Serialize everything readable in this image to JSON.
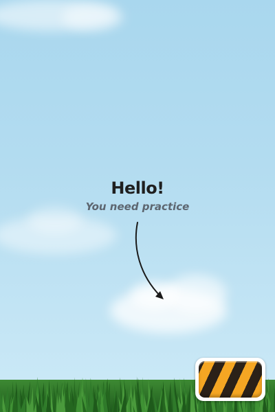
{
  "greeting": {
    "title": "Hello!",
    "subtitle": "You need practice"
  },
  "colors": {
    "sky_top": "#a9d7ee",
    "sky_bottom": "#cdeaf7",
    "grass": "#2f7a2a",
    "button_stripe_orange": "#f5a623",
    "button_stripe_dark": "#2b2118"
  },
  "icons": {
    "pointer_arrow": "curved-arrow-icon",
    "action_button": "hazard-stripe-button"
  }
}
